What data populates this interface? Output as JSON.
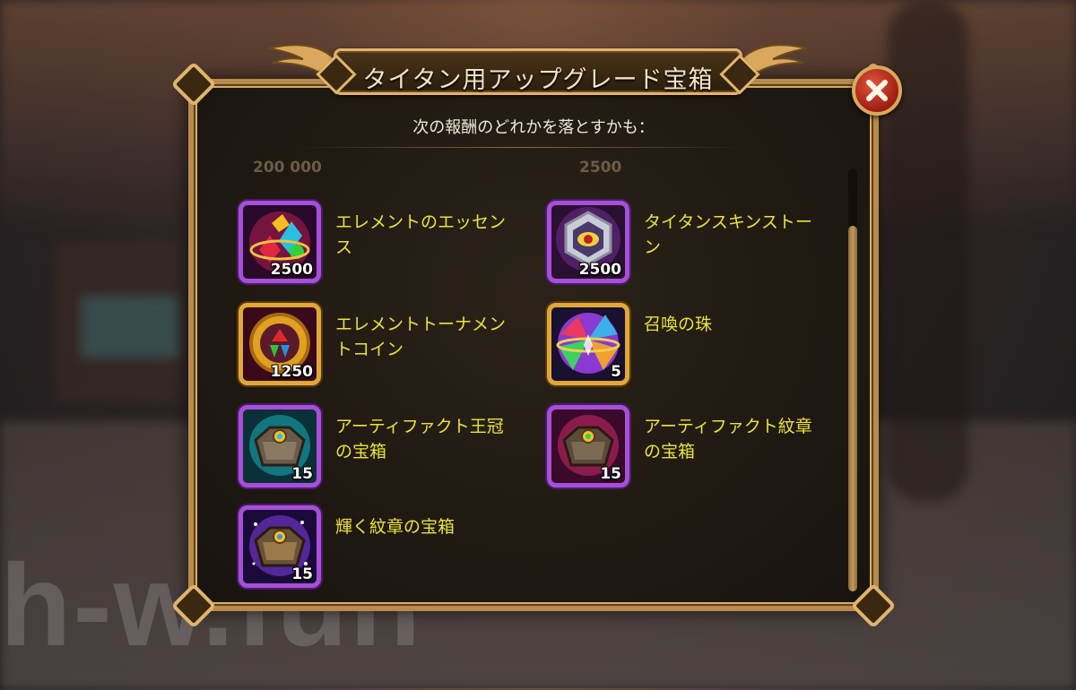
{
  "title": "タイタン用アップグレード宝箱",
  "subtitle": "次の報酬のどれかを落とすかも：",
  "watermark": "h-w.fun",
  "ghost_row": {
    "left_value": "200 000",
    "right_value": "2500"
  },
  "items": [
    {
      "name": "エレメントのエッセンス",
      "qty": "2500",
      "frame": "purple",
      "icon": "element-essence-icon"
    },
    {
      "name": "タイタンスキンストーン",
      "qty": "2500",
      "frame": "purple",
      "icon": "titan-skin-stone-icon"
    },
    {
      "name": "エレメントトーナメントコイン",
      "qty": "1250",
      "frame": "gold",
      "icon": "element-tournament-coin-icon"
    },
    {
      "name": "召喚の珠",
      "qty": "5",
      "frame": "gold",
      "icon": "summoning-sphere-icon"
    },
    {
      "name": "アーティファクト王冠の宝箱",
      "qty": "15",
      "frame": "purple",
      "icon": "artifact-crown-chest-icon"
    },
    {
      "name": "アーティファクト紋章の宝箱",
      "qty": "15",
      "frame": "purple",
      "icon": "artifact-emblem-chest-icon"
    },
    {
      "name": "輝く紋章の宝箱",
      "qty": "15",
      "frame": "purple",
      "icon": "shining-emblem-chest-icon"
    }
  ],
  "colors": {
    "name_text": "#ece23c",
    "frame_purple": "#a64fd8",
    "frame_gold": "#e0a838",
    "close_red": "#c8321e"
  }
}
